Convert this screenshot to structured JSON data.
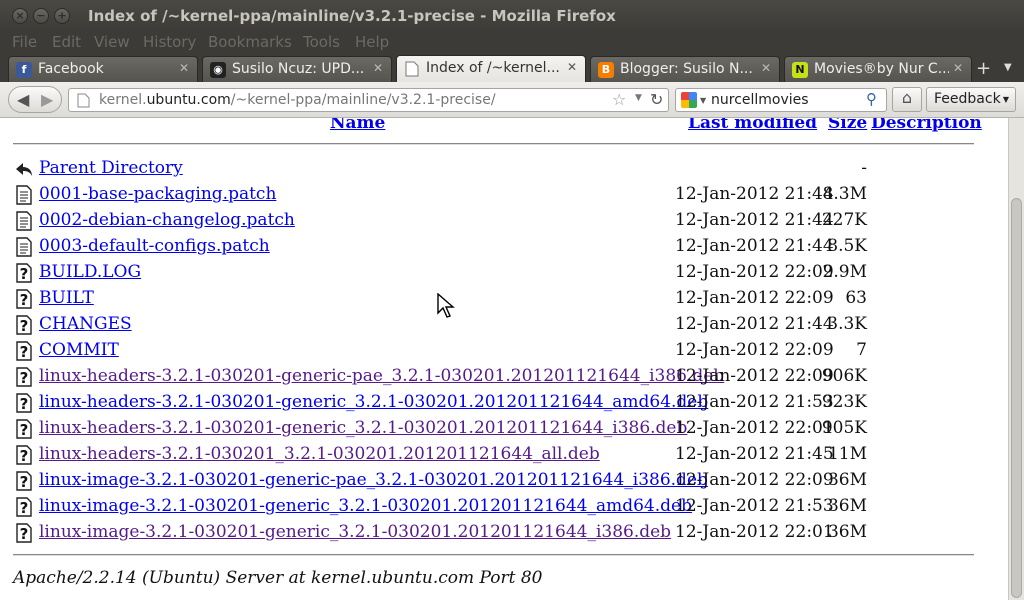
{
  "window": {
    "title": "Index of /~kernel-ppa/mainline/v3.2.1-precise - Mozilla Firefox"
  },
  "menu": [
    "File",
    "Edit",
    "View",
    "History",
    "Bookmarks",
    "Tools",
    "Help"
  ],
  "tabs": [
    {
      "label": "Facebook",
      "icon": "facebook-icon",
      "color": "#3b5998",
      "glyph": "f"
    },
    {
      "label": "Susilo Ncuz: UPD...",
      "icon": "site-favicon",
      "color": "#222222",
      "glyph": "◉"
    },
    {
      "label": "Index of /~kernel...",
      "icon": "page-icon",
      "color": "#ffffff",
      "glyph": ""
    },
    {
      "label": "Blogger: Susilo N...",
      "icon": "blogger-icon",
      "color": "#f57d00",
      "glyph": "B"
    },
    {
      "label": "Movies®by Nur C...",
      "icon": "movies-favicon",
      "color": "#c6e018",
      "glyph": "N"
    }
  ],
  "nav": {
    "url_prefix": "kernel.",
    "url_host": "ubuntu.com",
    "url_path": "/~kernel-ppa/mainline/v3.2.1-precise/",
    "search_value": "nurcellmovies",
    "feedback_label": "Feedback"
  },
  "listing": {
    "headers": {
      "name": "Name",
      "modified": "Last modified",
      "size": "Size",
      "description": "Description"
    },
    "parent": {
      "name": "Parent Directory",
      "size": "-"
    },
    "files": [
      {
        "name": "0001-base-packaging.patch",
        "modified": "12-Jan-2012 21:44",
        "size": "8.3M",
        "type": "text",
        "visited": false
      },
      {
        "name": "0002-debian-changelog.patch",
        "modified": "12-Jan-2012 21:44",
        "size": "227K",
        "type": "text",
        "visited": false
      },
      {
        "name": "0003-default-configs.patch",
        "modified": "12-Jan-2012 21:44",
        "size": "8.5K",
        "type": "text",
        "visited": false
      },
      {
        "name": "BUILD.LOG",
        "modified": "12-Jan-2012 22:09",
        "size": "2.9M",
        "type": "unknown",
        "visited": false
      },
      {
        "name": "BUILT",
        "modified": "12-Jan-2012 22:09",
        "size": "63",
        "type": "unknown",
        "visited": false
      },
      {
        "name": "CHANGES",
        "modified": "12-Jan-2012 21:44",
        "size": "3.3K",
        "type": "unknown",
        "visited": false
      },
      {
        "name": "COMMIT",
        "modified": "12-Jan-2012 22:09",
        "size": "7",
        "type": "unknown",
        "visited": false
      },
      {
        "name": "linux-headers-3.2.1-030201-generic-pae_3.2.1-030201.201201121644_i386.deb",
        "modified": "12-Jan-2012 22:09",
        "size": "906K",
        "type": "unknown",
        "visited": true
      },
      {
        "name": "linux-headers-3.2.1-030201-generic_3.2.1-030201.201201121644_amd64.deb",
        "modified": "12-Jan-2012 21:53",
        "size": "923K",
        "type": "unknown",
        "visited": false
      },
      {
        "name": "linux-headers-3.2.1-030201-generic_3.2.1-030201.201201121644_i386.deb",
        "modified": "12-Jan-2012 22:01",
        "size": "905K",
        "type": "unknown",
        "visited": true
      },
      {
        "name": "linux-headers-3.2.1-030201_3.2.1-030201.201201121644_all.deb",
        "modified": "12-Jan-2012 21:45",
        "size": "11M",
        "type": "unknown",
        "visited": true
      },
      {
        "name": "linux-image-3.2.1-030201-generic-pae_3.2.1-030201.201201121644_i386.deb",
        "modified": "12-Jan-2012 22:09",
        "size": "36M",
        "type": "unknown",
        "visited": false
      },
      {
        "name": "linux-image-3.2.1-030201-generic_3.2.1-030201.201201121644_amd64.deb",
        "modified": "12-Jan-2012 21:53",
        "size": "36M",
        "type": "unknown",
        "visited": false
      },
      {
        "name": "linux-image-3.2.1-030201-generic_3.2.1-030201.201201121644_i386.deb",
        "modified": "12-Jan-2012 22:01",
        "size": "36M",
        "type": "unknown",
        "visited": true
      }
    ],
    "footer": "Apache/2.2.14 (Ubuntu) Server at kernel.ubuntu.com Port 80"
  }
}
